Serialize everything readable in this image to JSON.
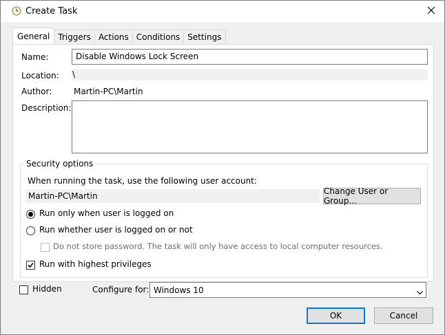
{
  "window": {
    "title": "Create Task"
  },
  "tabs": [
    {
      "label": "General"
    },
    {
      "label": "Triggers"
    },
    {
      "label": "Actions"
    },
    {
      "label": "Conditions"
    },
    {
      "label": "Settings"
    }
  ],
  "general": {
    "name_label": "Name:",
    "name_value": "Disable Windows Lock Screen",
    "location_label": "Location:",
    "location_value": "\\",
    "author_label": "Author:",
    "author_value": "Martin-PC\\Martin",
    "description_label": "Description:",
    "description_value": ""
  },
  "security": {
    "title": "Security options",
    "account_prompt": "When running the task, use the following user account:",
    "account_value": "Martin-PC\\Martin",
    "change_button": "Change User or Group...",
    "radio_logged_on": "Run only when user is logged on",
    "radio_logged_on_selected": true,
    "radio_whether": "Run whether user is logged on or not",
    "radio_whether_selected": false,
    "no_store_password": "Do not store password.  The task will only have access to local computer resources.",
    "no_store_password_checked": false,
    "highest_privileges": "Run with highest privileges",
    "highest_privileges_checked": true
  },
  "bottom": {
    "hidden_label": "Hidden",
    "hidden_checked": false,
    "configure_label": "Configure for:",
    "configure_value": "Windows 10"
  },
  "buttons": {
    "ok": "OK",
    "cancel": "Cancel"
  },
  "colors": {
    "accent": "#0078d7",
    "window_bg": "#f0f0f0",
    "panel_bg": "#ffffff"
  }
}
